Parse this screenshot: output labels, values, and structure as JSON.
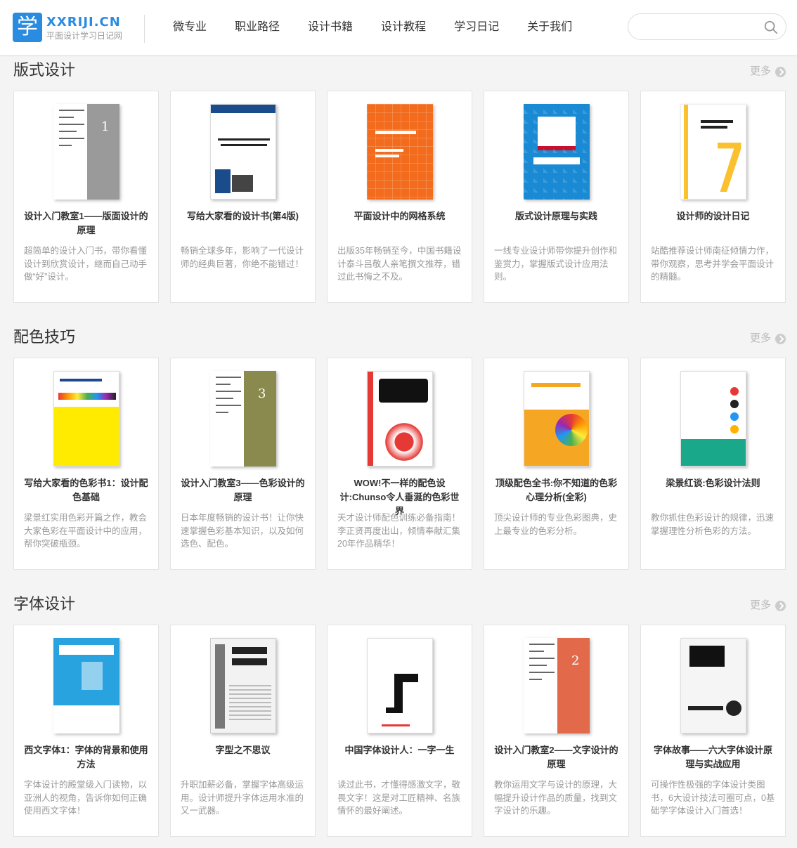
{
  "header": {
    "logo_glyph": "学",
    "logo_en": "XXRIJI.CN",
    "logo_cn": "平面设计学习日记网",
    "nav": [
      "微专业",
      "职业路径",
      "设计书籍",
      "设计教程",
      "学习日记",
      "关于我们"
    ],
    "search_placeholder": ""
  },
  "sections": [
    {
      "title": "版式设计",
      "more": "更多",
      "books": [
        {
          "title": "设计入门教室1——版面设计的原理",
          "desc": "超简单的设计入门书，带你看懂设计到欣赏设计，继而自己动手做“好”设计。",
          "cover_color": "#9a9a9a",
          "cover_style": "grey",
          "cover_num": "1"
        },
        {
          "title": "写给大家看的设计书(第4版)",
          "desc": "畅销全球多年，影响了一代设计师的经典巨著，你绝不能错过！",
          "cover_color": "#ffffff",
          "cover_style": "white"
        },
        {
          "title": "平面设计中的网格系统",
          "desc": "出版35年畅销至今，中国书籍设计泰斗吕敬人亲笔撰文推荐，错过此书悔之不及。",
          "cover_color": "#f36b1c",
          "cover_style": "orange"
        },
        {
          "title": "版式设计原理与实践",
          "desc": "一线专业设计师带你提升创作和鉴赏力，掌握版式设计应用法则。",
          "cover_color": "#1a8ad4",
          "cover_style": "blue"
        },
        {
          "title": "设计师的设计日记",
          "desc": "站酷推荐设计师南征倾情力作，带你观察，思考并学会平面设计的精髓。",
          "cover_color": "#fbc02d",
          "cover_style": "diary"
        }
      ]
    },
    {
      "title": "配色技巧",
      "more": "更多",
      "books": [
        {
          "title": "写给大家看的色彩书1：设计配色基础",
          "desc": "梁景红实用色彩开篇之作，教会大家色彩在平面设计中的应用，帮你突破瓶颈。",
          "cover_color": "#ffeb00",
          "cover_style": "yellow"
        },
        {
          "title": "设计入门教室3——色彩设计的原理",
          "desc": "日本年度畅销的设计书！让你快速掌握色彩基本知识，以及如何选色、配色。",
          "cover_color": "#8a8a4e",
          "cover_style": "grey",
          "cover_num": "3"
        },
        {
          "title": "WOW!不一样的配色设计:Chunso令人垂涎的色彩世界",
          "desc": "天才设计师配色训练必备指南！李正贤再度出山，倾情奉献汇集20年作品精华！",
          "cover_color": "#e53935",
          "cover_style": "wow"
        },
        {
          "title": "顶级配色全书:你不知道的色彩心理分析(全彩)",
          "desc": "顶尖设计师的专业色彩图典，史上最专业的色彩分析。",
          "cover_color": "#f5a623",
          "cover_style": "colour"
        },
        {
          "title": "梁景红谈:色彩设计法则",
          "desc": "教你抓住色彩设计的规律，迅速掌握理性分析色彩的方法。",
          "cover_color": "#1aa88a",
          "cover_style": "teal"
        }
      ]
    },
    {
      "title": "字体设计",
      "more": "更多",
      "books": [
        {
          "title": "西文字体1：字体的背景和使用方法",
          "desc": "字体设计的殿堂级入门读物，以亚洲人的视角，告诉你如何正确使用西文字体！",
          "cover_color": "#29a3df",
          "cover_style": "western"
        },
        {
          "title": "字型之不思议",
          "desc": "升职加薪必备，掌握字体高级运用。设计师提升字体运用水准的又一武器。",
          "cover_color": "#f2f2f2",
          "cover_style": "zixing"
        },
        {
          "title": "中国字体设计人：一字一生",
          "desc": "读过此书，才懂得感激文字，敬畏文字！这是对工匠精神、名族情怀的最好阐述。",
          "cover_color": "#ffffff",
          "cover_style": "chinese"
        },
        {
          "title": "设计入门教室2——文字设计的原理",
          "desc": "教你运用文字与设计的原理，大幅提升设计作品的质量，找到文字设计的乐趣。",
          "cover_color": "#e2694a",
          "cover_style": "grey",
          "cover_num": "2"
        },
        {
          "title": "字体故事——六大字体设计原理与实战应用",
          "desc": "可操作性极强的字体设计类图书，6大设计技法可圈可点，0基础学字体设计入门首选！",
          "cover_color": "#f5f5f5",
          "cover_style": "story"
        }
      ]
    }
  ]
}
